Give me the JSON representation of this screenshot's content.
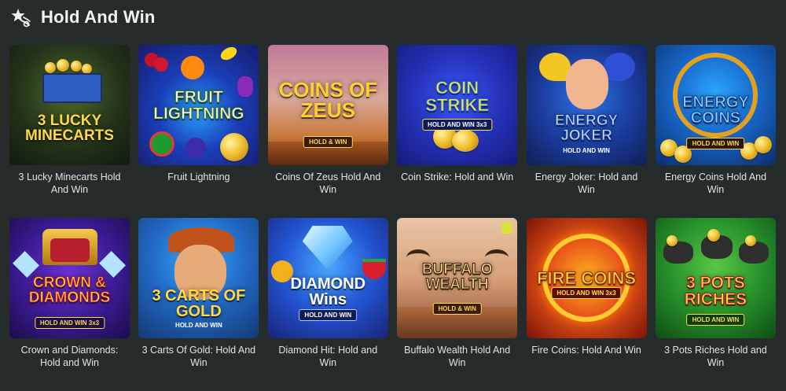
{
  "section": {
    "title": "Hold And Win",
    "icon": "shooting-star-icon"
  },
  "games": [
    {
      "name": "3 Lucky Minecarts Hold And Win",
      "logo": "3 LUCKY MINECARTS",
      "badge": ""
    },
    {
      "name": "Fruit Lightning",
      "logo": "FRUIT LIGHTNING",
      "badge": ""
    },
    {
      "name": "Coins Of Zeus Hold And Win",
      "logo": "COINS OF ZEUS",
      "badge": "HOLD & WIN"
    },
    {
      "name": "Coin Strike: Hold and Win",
      "logo": "COIN STRIKE",
      "badge": "HOLD AND WIN 3x3"
    },
    {
      "name": "Energy Joker: Hold and Win",
      "logo": "ENERGY JOKER",
      "badge": "HOLD AND WIN"
    },
    {
      "name": "Energy Coins Hold And Win",
      "logo": "ENERGY COINS",
      "badge": "HOLD AND WIN"
    },
    {
      "name": "Crown and Diamonds: Hold and Win",
      "logo": "CROWN & DIAMONDS",
      "badge": "HOLD AND WIN 3x3"
    },
    {
      "name": "3 Carts Of Gold: Hold And Win",
      "logo": "3 CARTS OF GOLD",
      "badge": "HOLD AND WIN"
    },
    {
      "name": "Diamond Hit: Hold and Win",
      "logo": "DIAMOND Wins",
      "badge": "HOLD AND WIN"
    },
    {
      "name": "Buffalo Wealth Hold And Win",
      "logo": "BUFFALO WEALTH",
      "badge": "HOLD & WIN"
    },
    {
      "name": "Fire Coins: Hold And Win",
      "logo": "FIRE COINS",
      "badge": "HOLD AND WIN 3x3"
    },
    {
      "name": "3 Pots Riches Hold and Win",
      "logo": "3 POTS RICHES",
      "badge": "HOLD AND WIN"
    }
  ]
}
